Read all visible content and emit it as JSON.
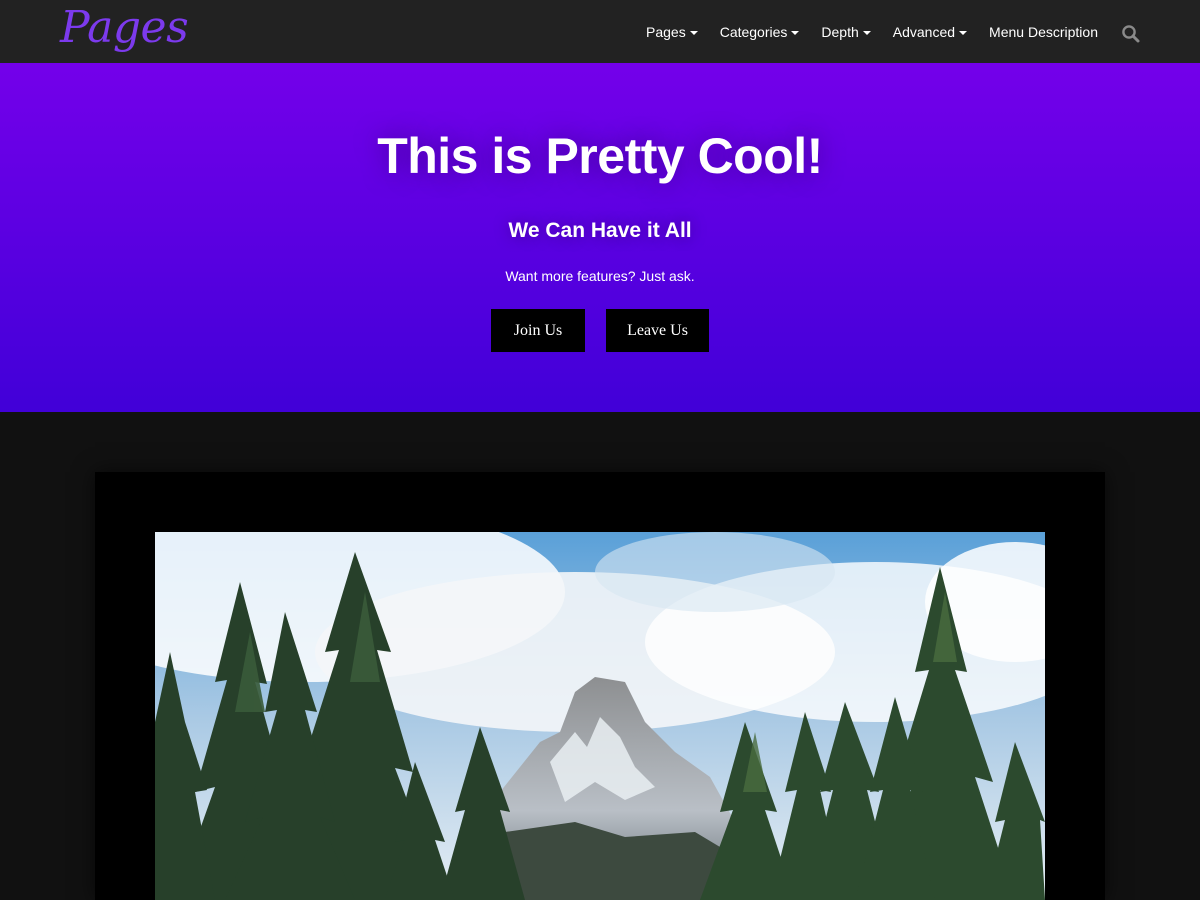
{
  "header": {
    "logo": "Pages",
    "nav": [
      {
        "label": "Pages",
        "has_dropdown": true
      },
      {
        "label": "Categories",
        "has_dropdown": true
      },
      {
        "label": "Depth",
        "has_dropdown": true
      },
      {
        "label": "Advanced",
        "has_dropdown": true
      },
      {
        "label": "Menu Description",
        "has_dropdown": false
      }
    ],
    "search_icon": "search-icon"
  },
  "hero": {
    "title": "This is Pretty Cool!",
    "subtitle": "We Can Have it All",
    "text": "Want more features? Just ask.",
    "buttons": {
      "join": "Join Us",
      "leave": "Leave Us"
    }
  },
  "colors": {
    "header_bg": "#222222",
    "logo": "#7c3aed",
    "hero_top": "#7400ea",
    "hero_bottom": "#4100d8",
    "page_bg": "#111111",
    "button_bg": "#000000"
  }
}
